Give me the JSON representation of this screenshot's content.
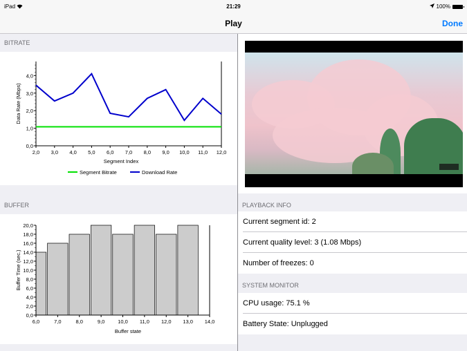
{
  "status_bar": {
    "device": "iPad",
    "wifi_icon": "wifi-icon",
    "time": "21:29",
    "location_icon": "location-arrow-icon",
    "battery_percent": "100%"
  },
  "nav": {
    "title": "Play",
    "done_label": "Done"
  },
  "sections": {
    "bitrate": "BITRATE",
    "buffer": "BUFFER",
    "playback_info": "PLAYBACK INFO",
    "system_monitor": "SYSTEM MONITOR"
  },
  "playback": {
    "segment_id": "Current segment id: 2",
    "quality_level": "Current quality level: 3 (1.08 Mbps)",
    "freezes": "Number of freezes: 0"
  },
  "system": {
    "cpu": "CPU usage: 75.1 %",
    "battery": "Battery State: Unplugged"
  },
  "chart_data": [
    {
      "type": "line",
      "xlabel": "Segment Index",
      "ylabel": "Data Rate (Mbps)",
      "xlim": [
        2,
        12
      ],
      "ylim": [
        0,
        4.8
      ],
      "xticks": [
        "2,0",
        "3,0",
        "4,0",
        "5,0",
        "6,0",
        "7,0",
        "8,0",
        "9,0",
        "10,0",
        "11,0",
        "12,0"
      ],
      "yticks": [
        "0,0",
        "1,0",
        "2,0",
        "3,0",
        "4,0"
      ],
      "series": [
        {
          "name": "Segment Bitrate",
          "color": "#00e000",
          "x": [
            2,
            3,
            4,
            5,
            6,
            7,
            8,
            9,
            10,
            11,
            12
          ],
          "values": [
            1.08,
            1.08,
            1.08,
            1.08,
            1.08,
            1.08,
            1.08,
            1.08,
            1.08,
            1.08,
            1.08
          ]
        },
        {
          "name": "Download Rate",
          "color": "#0000cc",
          "x": [
            2,
            3,
            4,
            5,
            6,
            7,
            8,
            9,
            10,
            11,
            12
          ],
          "values": [
            3.45,
            2.55,
            3.0,
            4.1,
            1.85,
            1.65,
            2.7,
            3.2,
            1.45,
            2.7,
            1.8
          ]
        }
      ],
      "legend": "bottom"
    },
    {
      "type": "bar",
      "xlabel": "Buffer state",
      "ylabel": "Buffer Time (sec.)",
      "xlim": [
        6,
        14
      ],
      "ylim": [
        0,
        20
      ],
      "xticks": [
        "6,0",
        "7,0",
        "8,0",
        "9,0",
        "10,0",
        "11,0",
        "12,0",
        "13,0",
        "14,0"
      ],
      "yticks": [
        "0,0",
        "2,0",
        "4,0",
        "6,0",
        "8,0",
        "10,0",
        "12,0",
        "14,0",
        "16,0",
        "18,0",
        "20,0"
      ],
      "x": [
        6,
        7,
        8,
        9,
        10,
        11,
        12,
        13
      ],
      "values": [
        14,
        16,
        18,
        20,
        18,
        20,
        18,
        20
      ],
      "bar_color": "#cccccc"
    }
  ]
}
